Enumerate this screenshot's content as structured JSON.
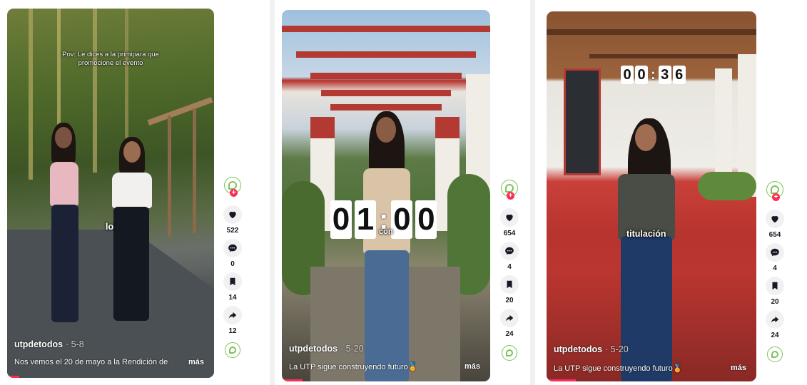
{
  "videos": [
    {
      "overlay_text": "Pov: Le dices a la primipara que promocione el evento",
      "caption_word": "lo",
      "author": "utpdetodos",
      "date": "· 5-8",
      "description": "Nos vemos el 20 de mayo a la Rendición de",
      "more_label": "más",
      "likes": "522",
      "comments": "0",
      "saves": "14",
      "shares": "12",
      "progress_fraction": 0.06
    },
    {
      "timer": {
        "d1": "0",
        "d2": "1",
        "d3": "0",
        "d4": "0"
      },
      "caption_word": "con",
      "author": "utpdetodos",
      "date": "· 5-20",
      "description": "La UTP sigue construyendo futuro🏅",
      "more_label": "más",
      "likes": "654",
      "comments": "4",
      "saves": "20",
      "shares": "24",
      "progress_fraction": 0.1
    },
    {
      "timer": {
        "d1": "0",
        "d2": "0",
        "d3": "3",
        "d4": "6"
      },
      "caption_word": "titulación",
      "author": "utpdetodos",
      "date": "· 5-20",
      "description": "La UTP sigue construyendo futuro🏅",
      "more_label": "más",
      "likes": "654",
      "comments": "4",
      "saves": "20",
      "shares": "24",
      "progress_fraction": 0.14
    }
  ],
  "icons": {
    "like": "heart-icon",
    "comment": "comment-icon",
    "save": "bookmark-icon",
    "share": "share-icon"
  },
  "colors": {
    "progress": "#fe2c55",
    "brand_green": "#7fc25a"
  }
}
